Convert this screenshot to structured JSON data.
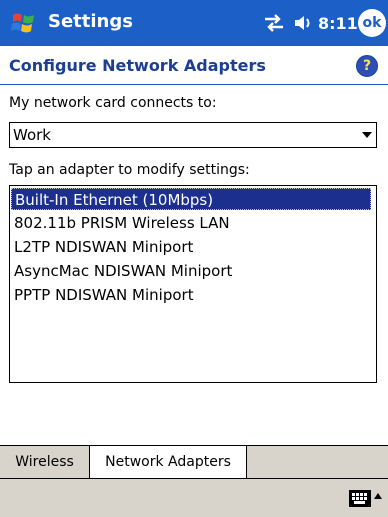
{
  "titlebar": {
    "title": "Settings",
    "clock": "8:11",
    "ok_label": "ok",
    "brand_color": "#1c5fc7"
  },
  "header": {
    "title": "Configure Network Adapters",
    "help_glyph": "?"
  },
  "network": {
    "connects_label": "My network card connects to:",
    "selected_value": "Work"
  },
  "adapters": {
    "label": "Tap an adapter to modify settings:",
    "items": [
      "Built-In Ethernet (10Mbps)",
      "802.11b PRISM Wireless LAN",
      "L2TP NDISWAN Miniport",
      "AsyncMac NDISWAN Miniport",
      "PPTP NDISWAN Miniport"
    ],
    "selected_index": 0
  },
  "tabs": [
    {
      "label": "Wireless",
      "active": false
    },
    {
      "label": "Network Adapters",
      "active": true
    }
  ],
  "icons": {
    "start": "windows-flag-icon",
    "connectivity": "connectivity-arrows-icon",
    "volume": "speaker-icon",
    "help": "help-icon",
    "keyboard": "keyboard-icon"
  }
}
